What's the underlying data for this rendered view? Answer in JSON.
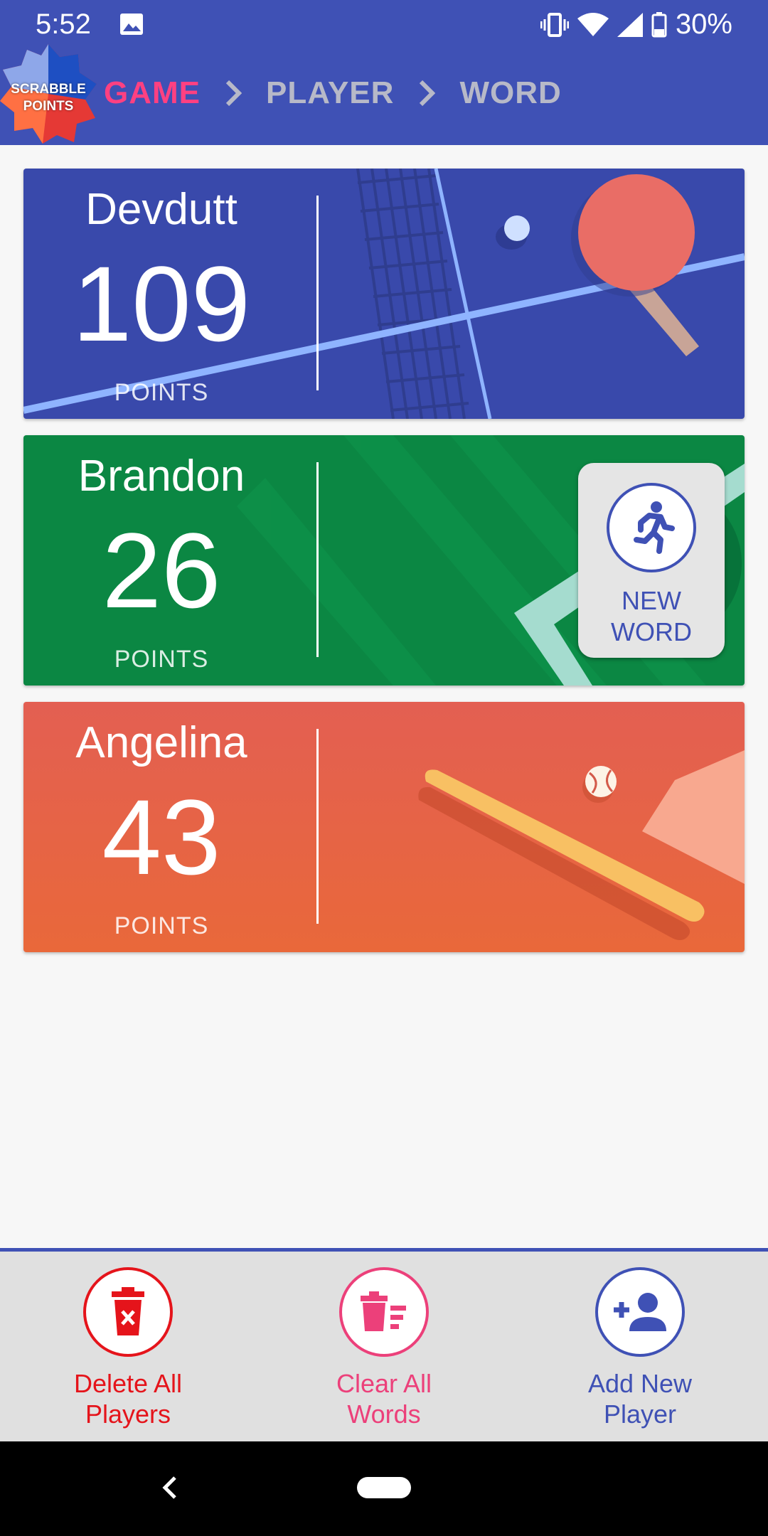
{
  "status_bar": {
    "time": "5:52",
    "battery": "30%",
    "icons": [
      "image-icon",
      "vibrate-icon",
      "wifi-icon",
      "signal-icon",
      "battery-icon"
    ]
  },
  "header": {
    "logo_text": "SCRABBLE\nPOINTS",
    "breadcrumbs": [
      {
        "label": "GAME",
        "active": true
      },
      {
        "label": "PLAYER",
        "active": false
      },
      {
        "label": "WORD",
        "active": false
      }
    ],
    "colors": {
      "bar": "#3f51b5",
      "active": "#ff4081",
      "inactive": "#b7b9c8"
    }
  },
  "players": [
    {
      "name": "Devdutt",
      "score": "109",
      "points_label": "POINTS",
      "theme": "ping-pong",
      "color": "#3949ab"
    },
    {
      "name": "Brandon",
      "score": "26",
      "points_label": "POINTS",
      "theme": "running",
      "color": "#0b8743"
    },
    {
      "name": "Angelina",
      "score": "43",
      "points_label": "POINTS",
      "theme": "baseball",
      "color": "#e8633f"
    }
  ],
  "new_word_button": {
    "label": "NEW\nWORD",
    "icon": "running-person-icon"
  },
  "bottom_actions": [
    {
      "label": "Delete All\nPlayers",
      "icon": "delete-icon",
      "color": "#e5141b"
    },
    {
      "label": "Clear All\nWords",
      "icon": "clear-list-icon",
      "color": "#ec407a"
    },
    {
      "label": "Add New\nPlayer",
      "icon": "add-person-icon",
      "color": "#3f51b5"
    }
  ],
  "nav_bar": {
    "icons": [
      "back-icon",
      "home-pill"
    ]
  }
}
